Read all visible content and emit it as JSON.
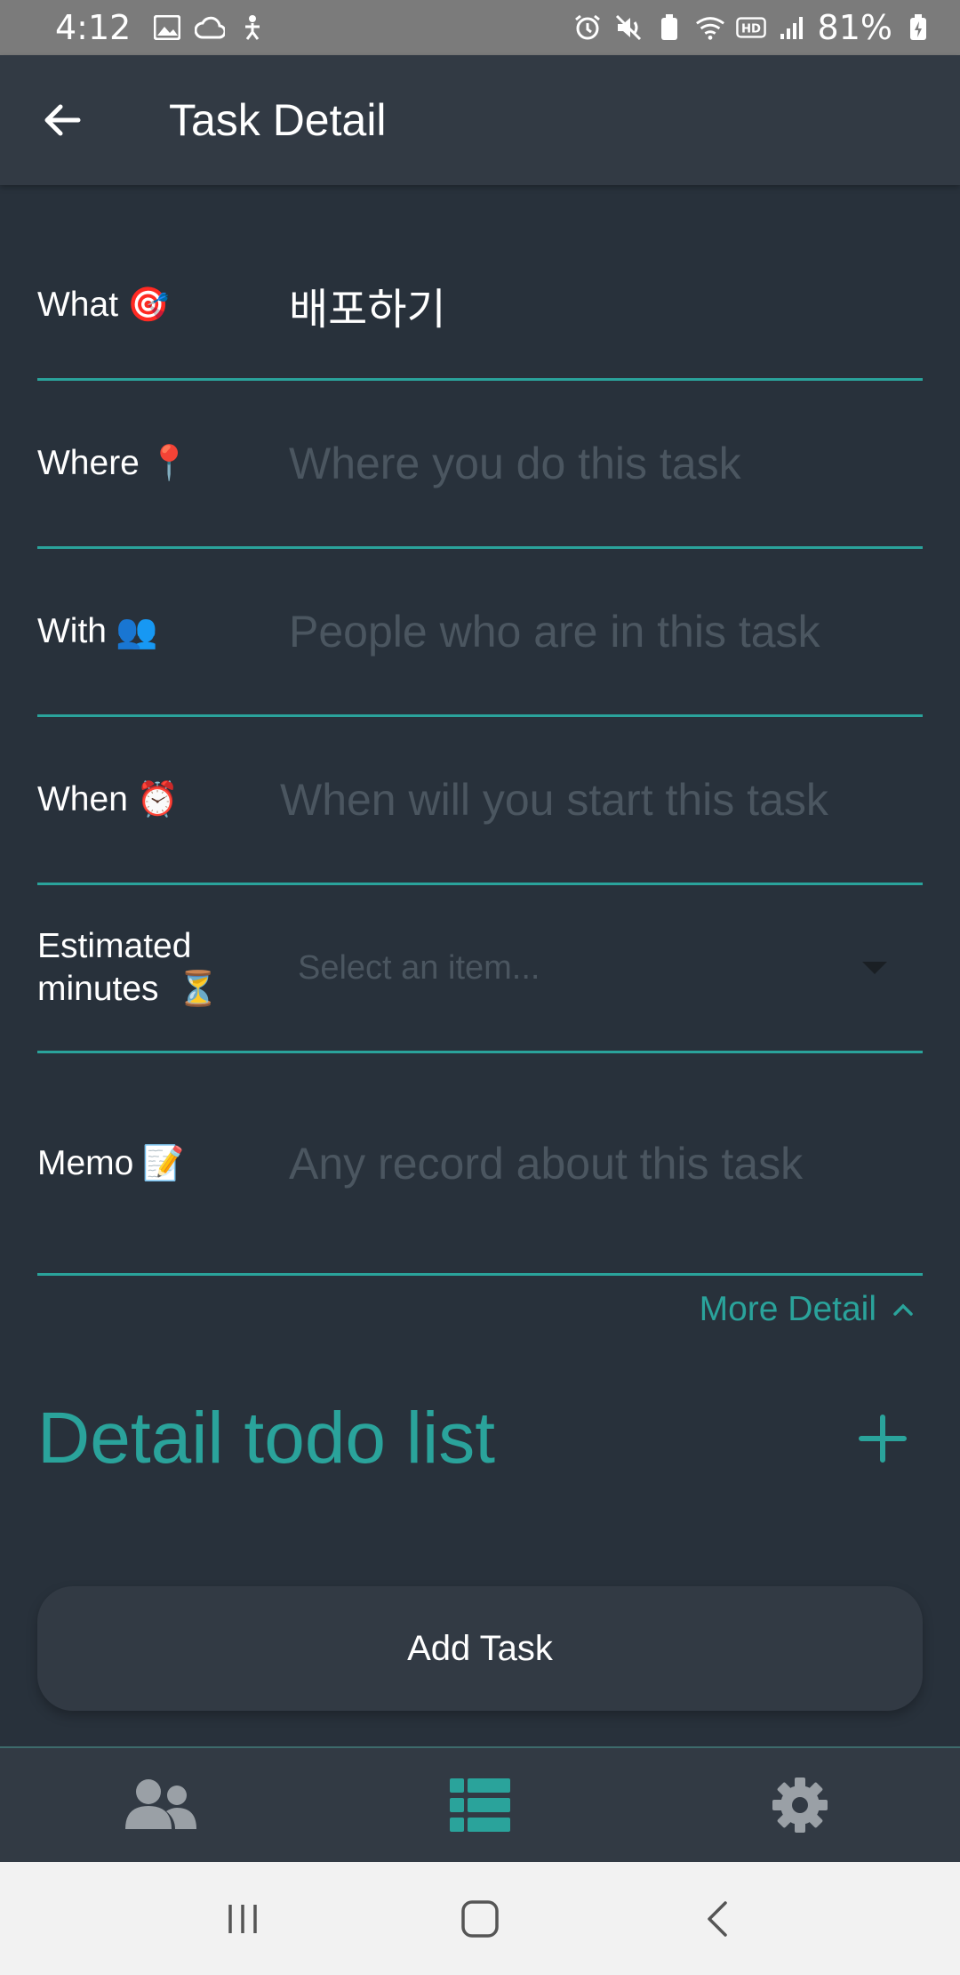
{
  "status_bar": {
    "time": "4:12",
    "battery": "81%",
    "left_icons": [
      "gallery-icon",
      "cloud-icon",
      "accessibility-icon"
    ],
    "right_icons": [
      "alarm-icon",
      "mute-icon",
      "battery-saver-icon",
      "wifi-icon",
      "hd-icon",
      "signal-icon",
      "battery-charging-icon"
    ]
  },
  "app_bar": {
    "title": "Task Detail",
    "back_icon": "arrow-left-icon"
  },
  "form": {
    "what": {
      "label": "What",
      "emoji": "🎯",
      "value": "배포하기"
    },
    "where": {
      "label": "Where",
      "emoji": "📍",
      "placeholder": "Where you do this task"
    },
    "with": {
      "label": "With",
      "emoji": "👥",
      "placeholder": "People who are in this task"
    },
    "when": {
      "label": "When",
      "emoji": "⏰",
      "placeholder": "When will you start this task"
    },
    "estimated": {
      "label_line1": "Estimated",
      "label_line2": "minutes",
      "emoji": "⏳",
      "placeholder": "Select an item..."
    },
    "memo": {
      "label": "Memo",
      "emoji": "📝",
      "placeholder": "Any record about this task"
    }
  },
  "more_detail": {
    "label": "More Detail",
    "icon": "chevron-up-icon"
  },
  "todo": {
    "title": "Detail todo list",
    "add_icon": "plus-icon"
  },
  "add_task_button": {
    "label": "Add Task"
  },
  "bottom_nav": {
    "items": [
      {
        "name": "people",
        "icon": "users-icon",
        "active": false
      },
      {
        "name": "tasks",
        "icon": "list-icon",
        "active": true
      },
      {
        "name": "settings",
        "icon": "gear-icon",
        "active": false
      }
    ]
  },
  "colors": {
    "accent": "#2aa39b",
    "background": "#28313b",
    "surface": "#323a44",
    "placeholder": "#4b5660",
    "inactive_icon": "#9aa0a6"
  }
}
